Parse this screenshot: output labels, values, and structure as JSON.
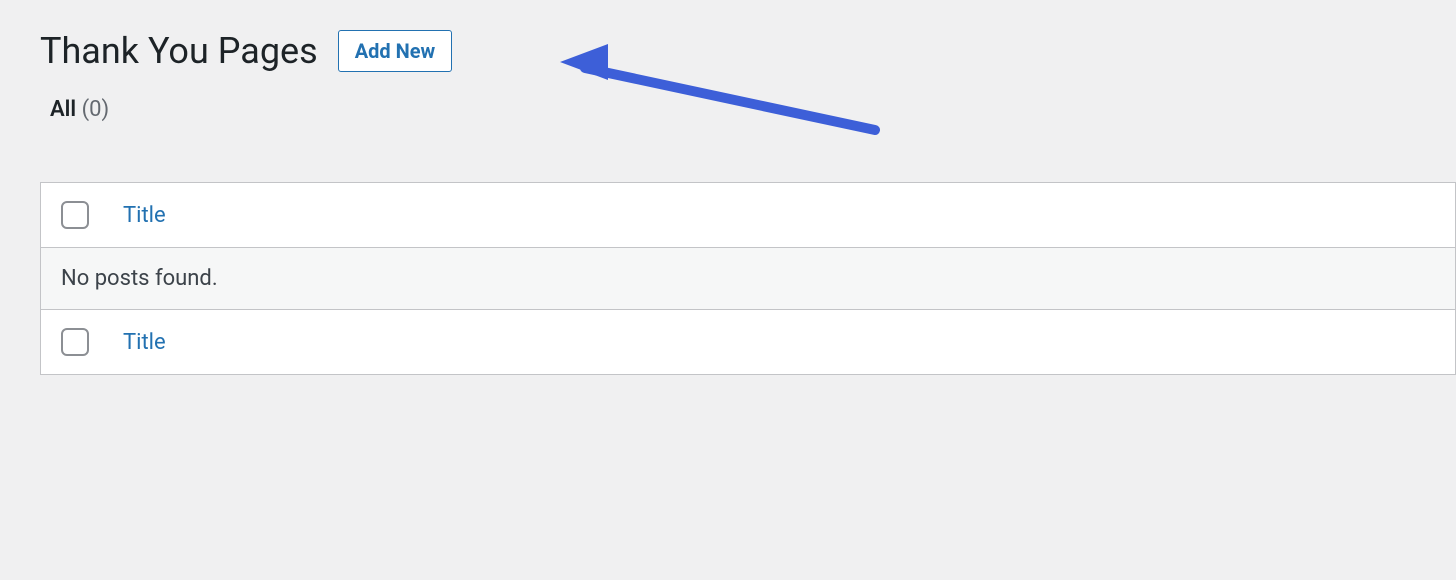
{
  "header": {
    "title": "Thank You Pages",
    "add_new_label": "Add New"
  },
  "filters": {
    "all_label": "All",
    "all_count": "(0)"
  },
  "table": {
    "column_title": "Title",
    "empty_message": "No posts found."
  }
}
